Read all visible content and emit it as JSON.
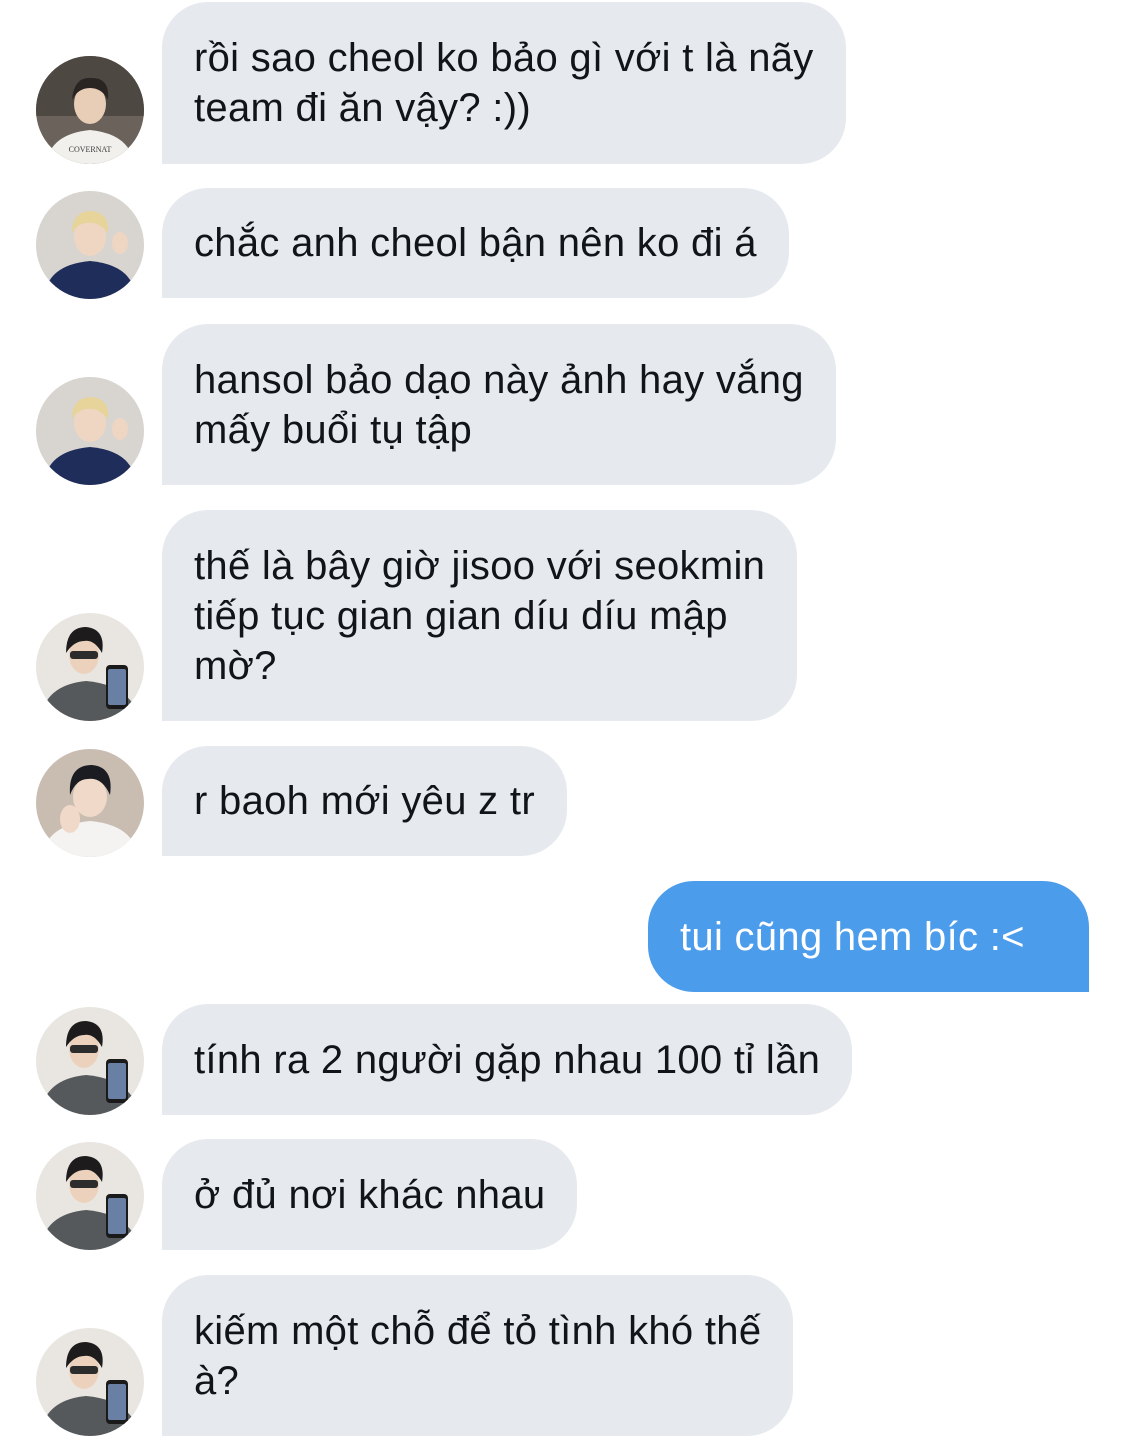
{
  "conversation": {
    "messages": [
      {
        "direction": "incoming",
        "avatar": "white-shirt-avatar",
        "text": "rồi sao cheol ko bảo gì với t là nãy\nteam đi ăn vậy? :))",
        "avatar_badge": "COVERNAT"
      },
      {
        "direction": "incoming",
        "avatar": "blue-hoodie-blond-avatar",
        "text": "chắc anh cheol bận nên ko đi á"
      },
      {
        "direction": "incoming",
        "avatar": "blue-hoodie-blond-avatar",
        "text": "hansol bảo dạo này ảnh hay vắng\nmấy buổi tụ tập"
      },
      {
        "direction": "incoming",
        "avatar": "mirror-selfie-avatar",
        "text": "thế là bây giờ jisoo với seokmin\ntiếp tục gian gian díu díu mập\nmờ?"
      },
      {
        "direction": "incoming",
        "avatar": "dark-hair-white-shirt-avatar",
        "text": "r baoh mới yêu z tr"
      },
      {
        "direction": "outgoing",
        "text": "tui cũng hem bíc :<"
      },
      {
        "direction": "incoming",
        "avatar": "mirror-selfie-avatar",
        "text": "tính ra 2 người gặp nhau 100 tỉ lần"
      },
      {
        "direction": "incoming",
        "avatar": "mirror-selfie-avatar",
        "text": "ở đủ nơi khác nhau"
      },
      {
        "direction": "incoming",
        "avatar": "mirror-selfie-avatar",
        "text": "kiếm một chỗ để tỏ tình khó thế\nà?"
      }
    ]
  },
  "colors": {
    "incoming_bubble": "#e6eaef",
    "outgoing_bubble": "#4c9cec",
    "incoming_text": "#111418",
    "outgoing_text": "#ffffff"
  }
}
